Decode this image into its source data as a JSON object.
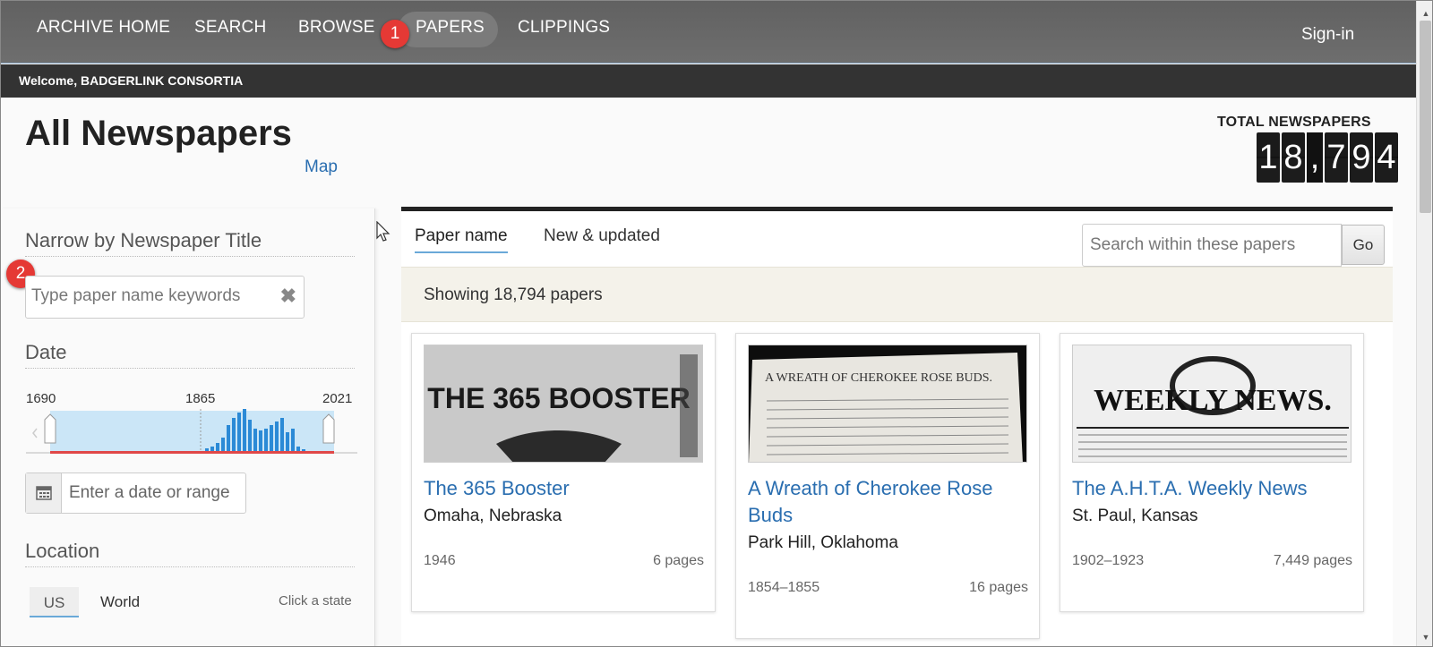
{
  "nav": {
    "items": [
      "ARCHIVE HOME",
      "SEARCH",
      "BROWSE",
      "PAPERS",
      "CLIPPINGS"
    ],
    "signin": "Sign-in"
  },
  "badges": {
    "one": "1",
    "two": "2"
  },
  "welcome": "Welcome, BADGERLINK CONSORTIA",
  "header": {
    "title": "All Newspapers",
    "map_link": "Map",
    "total_label": "TOTAL NEWSPAPERS",
    "total_digits": [
      "1",
      "8",
      ",",
      "7",
      "9",
      "4"
    ]
  },
  "sidebar": {
    "title_section": "Narrow by Newspaper Title",
    "title_placeholder": "Type paper name keywords",
    "clear_glyph": "✖",
    "date_section": "Date",
    "date_start": "1690",
    "date_mid": "1865",
    "date_end": "2021",
    "date_placeholder": "Enter a date or range",
    "location_section": "Location",
    "location_tabs": [
      "US",
      "World"
    ],
    "location_hint": "Click a state"
  },
  "main": {
    "tabs": [
      "Paper name",
      "New & updated"
    ],
    "search_placeholder": "Search within these papers",
    "go_label": "Go",
    "showing": "Showing 18,794 papers",
    "cards": [
      {
        "title": "The 365 Booster",
        "place": "Omaha, Nebraska",
        "years": "1946",
        "pages": "6 pages",
        "masthead": "THE 365 BOOSTER"
      },
      {
        "title": "A Wreath of Cherokee Rose Buds",
        "place": "Park Hill, Oklahoma",
        "years": "1854–1855",
        "pages": "16 pages",
        "masthead": "A WREATH OF CHEROKEE ROSE BUDS."
      },
      {
        "title": "The A.H.T.A. Weekly News",
        "place": "St. Paul, Kansas",
        "years": "1902–1923",
        "pages": "7,449 pages",
        "masthead": "WEEKLY NEWS."
      }
    ]
  },
  "colors": {
    "link": "#2a6eb0",
    "badge": "#e53935",
    "nav_bg": "#666666",
    "histogram_bar": "#2b8ad6"
  }
}
